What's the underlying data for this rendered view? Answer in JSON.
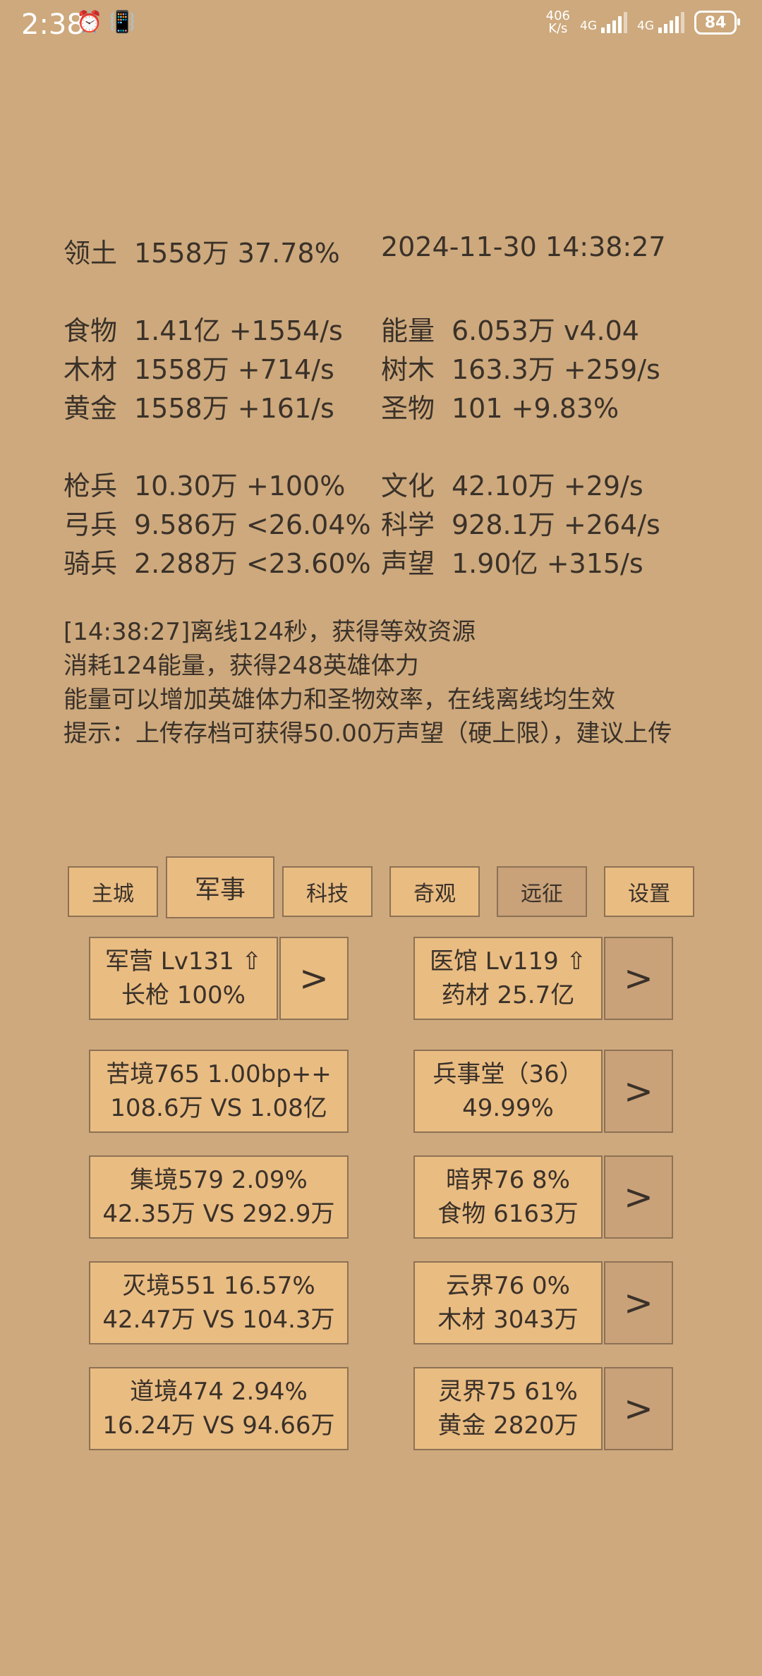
{
  "status_bar": {
    "time": "2:38",
    "net_speed_value": "406",
    "net_speed_unit": "K/s",
    "sim1_label": "4G",
    "sim2_label": "4G",
    "battery": "84",
    "alarm_icon": "alarm-icon",
    "vibrate_icon": "vibrate-icon"
  },
  "header": {
    "territory_label": "领土",
    "territory_value": "1558万  37.78%",
    "datetime": "2024-11-30 14:38:27"
  },
  "resources": [
    {
      "label": "食物",
      "value": "1.41亿 +1554/s"
    },
    {
      "label": "木材",
      "value": "1558万 +714/s"
    },
    {
      "label": "黄金",
      "value": "1558万 +161/s"
    }
  ],
  "resources_right": [
    {
      "label": "能量",
      "value": "6.053万  v4.04"
    },
    {
      "label": "树木",
      "value": "163.3万 +259/s"
    },
    {
      "label": "圣物",
      "value": "101 +9.83%"
    }
  ],
  "troops": [
    {
      "label": "枪兵",
      "value": "10.30万 +100%"
    },
    {
      "label": "弓兵",
      "value": "9.586万 <26.04%"
    },
    {
      "label": "骑兵",
      "value": "2.288万 <23.60%"
    }
  ],
  "civ": [
    {
      "label": "文化",
      "value": "42.10万 +29/s"
    },
    {
      "label": "科学",
      "value": "928.1万 +264/s"
    },
    {
      "label": "声望",
      "value": "1.90亿 +315/s"
    }
  ],
  "log_lines": [
    "[14:38:27]离线124秒，获得等效资源",
    "消耗124能量，获得248英雄体力",
    "能量可以增加英雄体力和圣物效率，在线离线均生效",
    "提示：上传存档可获得50.00万声望（硬上限），建议上传"
  ],
  "tabs": [
    "主城",
    "军事",
    "科技",
    "奇观",
    "远征",
    "设置"
  ],
  "arrow_label": ">",
  "barracks": {
    "line1": "军营 Lv131 ⇧",
    "line2": "长枪 100%"
  },
  "hospital": {
    "line1": "医馆 Lv119 ⇧",
    "line2": "药材 25.7亿"
  },
  "realms_left": [
    {
      "line1": "苦境765  1.00bp++",
      "line2": "108.6万 VS 1.08亿"
    },
    {
      "line1": "集境579  2.09%",
      "line2": "42.35万 VS 292.9万"
    },
    {
      "line1": "灭境551  16.57%",
      "line2": "42.47万 VS 104.3万"
    },
    {
      "line1": "道境474  2.94%",
      "line2": "16.24万 VS 94.66万"
    }
  ],
  "realms_right": [
    {
      "line1": "兵事堂（36）",
      "line2": "49.99%"
    },
    {
      "line1": "暗界76  8%",
      "line2": "食物 6163万"
    },
    {
      "line1": "云界76  0%",
      "line2": "木材 3043万"
    },
    {
      "line1": "灵界75  61%",
      "line2": "黄金 2820万"
    }
  ]
}
